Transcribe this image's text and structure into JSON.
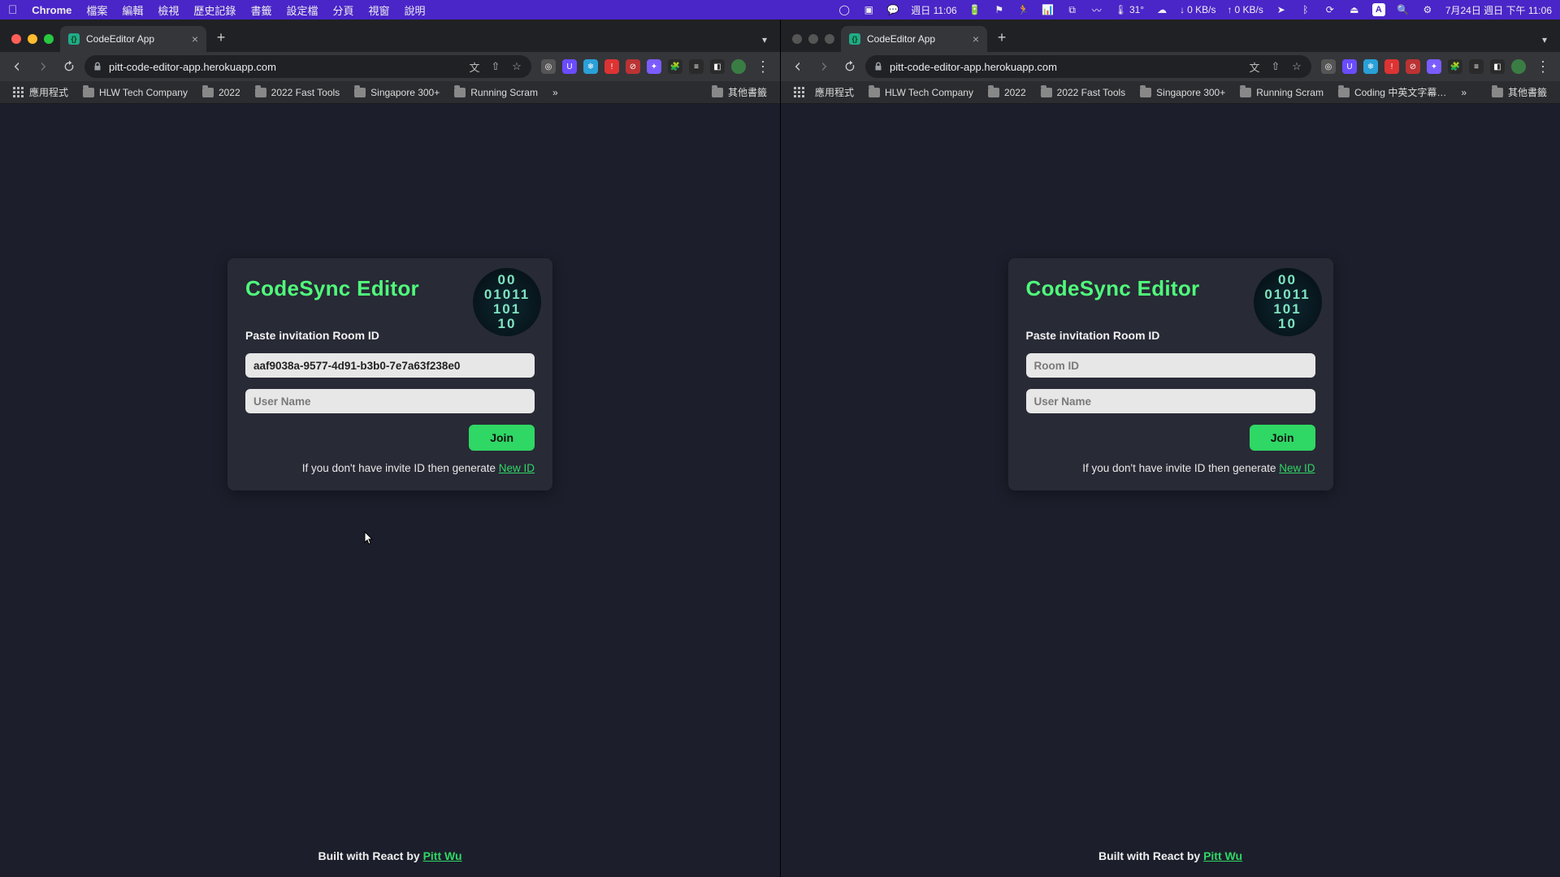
{
  "menubar": {
    "app": "Chrome",
    "items": [
      "檔案",
      "編輯",
      "檢視",
      "歷史記錄",
      "書籤",
      "設定檔",
      "分頁",
      "視窗",
      "說明"
    ],
    "status": {
      "day_time": "週日 11:06",
      "temp": "31°",
      "net_down": "0 KB/s",
      "net_up": "0 KB/s",
      "date_full": "7月24日 週日 下午 11:06"
    }
  },
  "windows": [
    {
      "active": true,
      "tab_title": "CodeEditor App",
      "url": "pitt-code-editor-app.herokuapp.com",
      "bookmarks": [
        "應用程式",
        "HLW Tech Company",
        "2022",
        "2022 Fast Tools",
        "Singapore 300+",
        "Running Scram"
      ],
      "bookmarks_overflow": "»",
      "bookmarks_right": "其他書籤",
      "app": {
        "title": "CodeSync Editor",
        "paste_label": "Paste invitation Room ID",
        "room_value": "aaf9038a-9577-4d91-b3b0-7e7a63f238e0",
        "room_placeholder": "Room ID",
        "user_placeholder": "User Name",
        "user_value": "",
        "join": "Join",
        "hint_text": "If you don't have invite ID then generate ",
        "new_id": "New ID",
        "footer_text": "Built with React by ",
        "footer_link": "Pitt Wu",
        "logo_text": "00\n01011\n101\n10"
      }
    },
    {
      "active": false,
      "tab_title": "CodeEditor App",
      "url": "pitt-code-editor-app.herokuapp.com",
      "bookmarks": [
        "應用程式",
        "HLW Tech Company",
        "2022",
        "2022 Fast Tools",
        "Singapore 300+",
        "Running Scram",
        "Coding 中英文字幕…"
      ],
      "bookmarks_overflow": "»",
      "bookmarks_right": "其他書籤",
      "app": {
        "title": "CodeSync Editor",
        "paste_label": "Paste invitation Room ID",
        "room_value": "",
        "room_placeholder": "Room ID",
        "user_placeholder": "User Name",
        "user_value": "",
        "join": "Join",
        "hint_text": "If you don't have invite ID then generate ",
        "new_id": "New ID",
        "footer_text": "Built with React by ",
        "footer_link": "Pitt Wu",
        "logo_text": "00\n01011\n101\n10"
      }
    }
  ]
}
